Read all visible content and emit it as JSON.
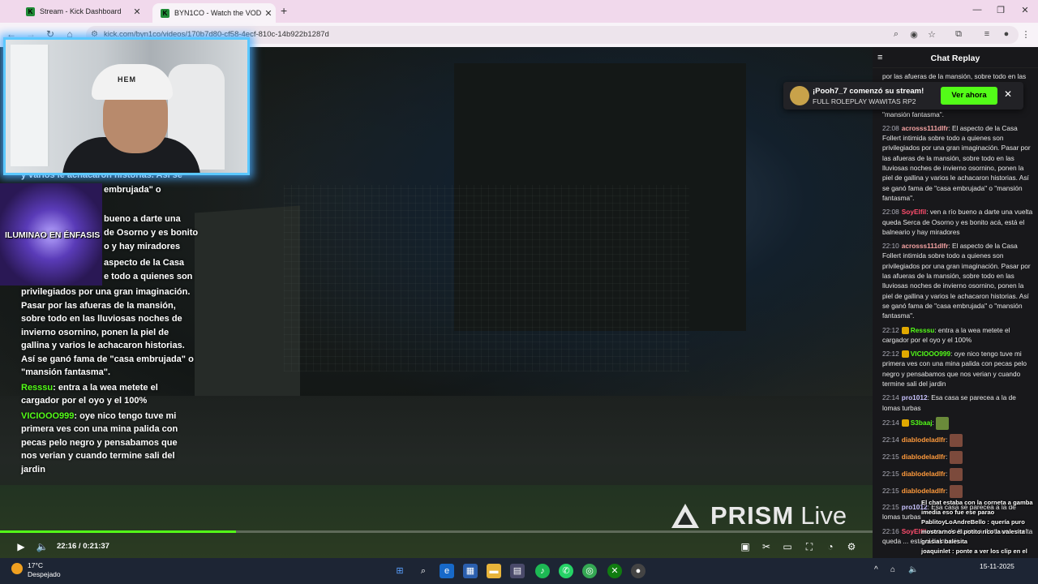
{
  "browser": {
    "tabs": [
      {
        "title": "Stream - Kick Dashboard",
        "favicon": "K"
      },
      {
        "title": "BYN1CO - Watch the VOD on Kick",
        "favicon": "K"
      }
    ],
    "new_tab": "+",
    "url": "kick.com/byn1co/videos/170b7d80-cf58-4ecf-810c-14b922b1287d"
  },
  "video": {
    "alert_text": "ILUMINAO EN ÉNFASIS",
    "cap_logo": "HEM",
    "partial_lines": [
      "y varios le achacaron historias. Así se",
      "embrujada\" o",
      "bueno a darte una",
      "de Osorno y es bonito",
      "o y hay miradores",
      "aspecto de la Casa",
      "e todo a quienes son"
    ],
    "overlay_chat": [
      {
        "user": "",
        "text": "privilegiados por una gran imaginación. Pasar por las afueras de la mansión, sobre todo en las lluviosas noches de invierno osornino, ponen la piel de gallina y varios le achacaron historias. Así se ganó fama de \"casa embrujada\" o \"mansión fantasma\"."
      },
      {
        "user": "Resssu",
        "text": ": entra a la wea metete el cargador por el oyo y el 100%",
        "color": "#53fc18"
      },
      {
        "user": "VICIOOO999",
        "text": ": oye nico tengo tuve mi primera ves con una mina palida con pecas pelo negro y pensabamos que nos verian y cuando termine sali del jardin",
        "color": "#53fc18"
      }
    ],
    "watermark_bold": "PRISM",
    "watermark_light": "Live",
    "progress": 0.27,
    "time": "22:16 / 0:21:37"
  },
  "chat": {
    "title": "Chat Replay",
    "messages": [
      {
        "ts": "",
        "user": "",
        "text": "por las afueras de la mansión, sobre todo en las lluviosas noches de invierno osornino..."
      },
      {
        "ts": "",
        "user": "",
        "text": "\"mansión fantasma\"."
      },
      {
        "ts": "22:08",
        "user": "acrosss111dlfr",
        "color": "#f5a3a3",
        "text": ": El aspecto de la Casa Follert intimida sobre todo a quienes son privilegiados por una gran imaginación. Pasar por las afueras de la mansión, sobre todo en las lluviosas noches de invierno osornino, ponen la piel de gallina y varios le achacaron historias. Así se ganó fama de \"casa embrujada\" o \"mansión fantasma\"."
      },
      {
        "ts": "22:08",
        "user": "SoyElfil",
        "color": "#ff4d6d",
        "text": ": ven a río bueno a darte una vuelta queda Serca de Osorno y es bonito acá, está el balneario y hay miradores"
      },
      {
        "ts": "22:10",
        "user": "acrosss111dlfr",
        "color": "#f5a3a3",
        "text": ": El aspecto de la Casa Follert intimida sobre todo a quienes son privilegiados por una gran imaginación. Pasar por las afueras de la mansión, sobre todo en las lluviosas noches de invierno osornino, ponen la piel de gallina y varios le achacaron historias. Así se ganó fama de \"casa embrujada\" o \"mansión fantasma\"."
      },
      {
        "ts": "22:12",
        "user": "Resssu",
        "color": "#53fc18",
        "text": ": entra a la wea metete el cargador por el oyo y el 100%"
      },
      {
        "ts": "22:12",
        "user": "VICIOOO999",
        "color": "#53fc18",
        "text": ": oye nico tengo tuve mi primera ves con una mina palida con pecas pelo negro y pensabamos que nos verian y cuando termine sali del jardin"
      },
      {
        "ts": "22:14",
        "user": "pro1012",
        "color": "#c9c3ff",
        "text": ": Esa casa se parecea a la de lomas turbas"
      },
      {
        "ts": "22:14",
        "user": "S3baaj",
        "color": "#53fc18",
        "text": ":"
      },
      {
        "ts": "22:14",
        "user": "diablodeladlfr",
        "color": "#ff9a3c",
        "text": ":"
      },
      {
        "ts": "22:15",
        "user": "diablodeladlfr",
        "color": "#ff9a3c",
        "text": ":"
      },
      {
        "ts": "22:15",
        "user": "diablodeladlfr",
        "color": "#ff9a3c",
        "text": ":"
      },
      {
        "ts": "22:15",
        "user": "diablodeladlfr",
        "color": "#ff9a3c",
        "text": ":"
      },
      {
        "ts": "22:15",
        "user": "pro1012",
        "color": "#c9c3ff",
        "text": ": Esa casa se parecea a la de lomas turbas"
      },
      {
        "ts": "22:16",
        "user": "SoyElfil",
        "color": "#ff4d6d",
        "text": ": ven a río bueno a darte una vuelta queda ... está el balneario"
      }
    ],
    "toast": {
      "title": "¡Pooh7_7 comenzó su stream!",
      "subtitle": "FULL ROLEPLAY WAWITAS RP2",
      "button": "Ver ahora"
    },
    "overlay_lines": [
      "El chat estaba con la corneta a gamba imedia eso fue ese parao",
      "PablitoyLoAndreBello : quería puro mostrarnos el potito rico la valesita grasias balesita",
      "joaquinlet : ponte a ver los clip en el aur"
    ]
  },
  "taskbar": {
    "temp": "17°C",
    "weather": "Despejado",
    "time": "",
    "date": "15-11-2025"
  },
  "colors": {
    "kick_green": "#53fc18",
    "cam_border": "#5bc8ff"
  }
}
